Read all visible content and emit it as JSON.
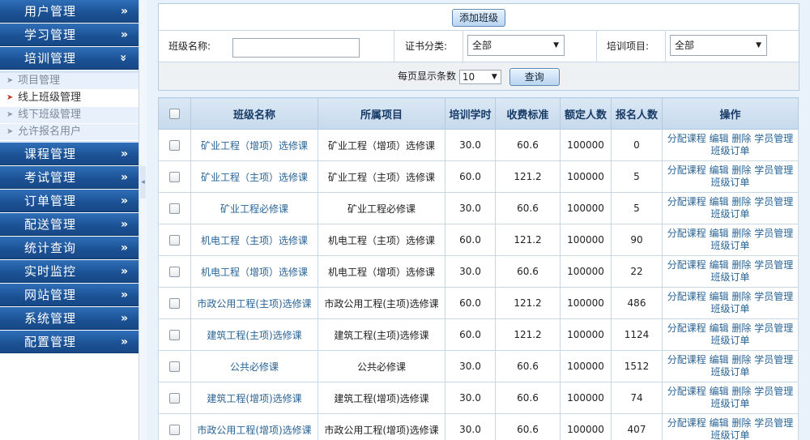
{
  "sidebar": {
    "top_menus": [
      {
        "label": "用户管理",
        "chev": "»"
      },
      {
        "label": "学习管理",
        "chev": "»"
      },
      {
        "label": "培训管理",
        "chev": "»"
      }
    ],
    "sub_items": [
      {
        "label": "项目管理",
        "active": false
      },
      {
        "label": "线上班级管理",
        "active": true
      },
      {
        "label": "线下班级管理",
        "active": false
      },
      {
        "label": "允许报名用户",
        "active": false
      }
    ],
    "bottom_menus": [
      {
        "label": "课程管理",
        "chev": "»"
      },
      {
        "label": "考试管理",
        "chev": "»"
      },
      {
        "label": "订单管理",
        "chev": "»"
      },
      {
        "label": "配送管理",
        "chev": "»"
      },
      {
        "label": "统计查询",
        "chev": "»"
      },
      {
        "label": "实时监控",
        "chev": "»"
      },
      {
        "label": "网站管理",
        "chev": "»"
      },
      {
        "label": "系统管理",
        "chev": "»"
      },
      {
        "label": "配置管理",
        "chev": "»"
      }
    ],
    "expanded_chev": "»"
  },
  "toolbar": {
    "add_label": "添加班级"
  },
  "filters": {
    "class_name_label": "班级名称:",
    "class_name_value": "",
    "cert_label": "证书分类:",
    "cert_value": "全部",
    "project_label": "培训项目:",
    "project_value": "全部"
  },
  "paging": {
    "per_page_label": "每页显示条数",
    "per_page_value": "10",
    "query_label": "查询"
  },
  "table": {
    "headers": [
      "班级名称",
      "所属项目",
      "培训学时",
      "收费标准",
      "额定人数",
      "报名人数",
      "操作"
    ],
    "ops": [
      "分配课程",
      "编辑",
      "删除",
      "学员管理",
      "班级订单"
    ],
    "rows": [
      {
        "name": "矿业工程（增项）选修课",
        "project": "矿业工程（增项）选修课",
        "hours": "30.0",
        "fee": "60.6",
        "quota": "100000",
        "enrolled": "0"
      },
      {
        "name": "矿业工程（主项）选修课",
        "project": "矿业工程（主项）选修课",
        "hours": "60.0",
        "fee": "121.2",
        "quota": "100000",
        "enrolled": "5"
      },
      {
        "name": "矿业工程必修课",
        "project": "矿业工程必修课",
        "hours": "30.0",
        "fee": "60.6",
        "quota": "100000",
        "enrolled": "5"
      },
      {
        "name": "机电工程（主项）选修课",
        "project": "机电工程（主项）选修课",
        "hours": "60.0",
        "fee": "121.2",
        "quota": "100000",
        "enrolled": "90"
      },
      {
        "name": "机电工程（增项）选修课",
        "project": "机电工程（增项）选修课",
        "hours": "30.0",
        "fee": "60.6",
        "quota": "100000",
        "enrolled": "22"
      },
      {
        "name": "市政公用工程(主项)选修课",
        "project": "市政公用工程(主项)选修课",
        "hours": "60.0",
        "fee": "121.2",
        "quota": "100000",
        "enrolled": "486"
      },
      {
        "name": "建筑工程(主项)选修课",
        "project": "建筑工程(主项)选修课",
        "hours": "60.0",
        "fee": "121.2",
        "quota": "100000",
        "enrolled": "1124"
      },
      {
        "name": "公共必修课",
        "project": "公共必修课",
        "hours": "30.0",
        "fee": "60.6",
        "quota": "100000",
        "enrolled": "1512"
      },
      {
        "name": "建筑工程(增项)选修课",
        "project": "建筑工程(增项)选修课",
        "hours": "30.0",
        "fee": "60.6",
        "quota": "100000",
        "enrolled": "74"
      },
      {
        "name": "市政公用工程(增项)选修课",
        "project": "市政公用工程(增项)选修课",
        "hours": "30.0",
        "fee": "60.6",
        "quota": "100000",
        "enrolled": "407"
      }
    ]
  }
}
